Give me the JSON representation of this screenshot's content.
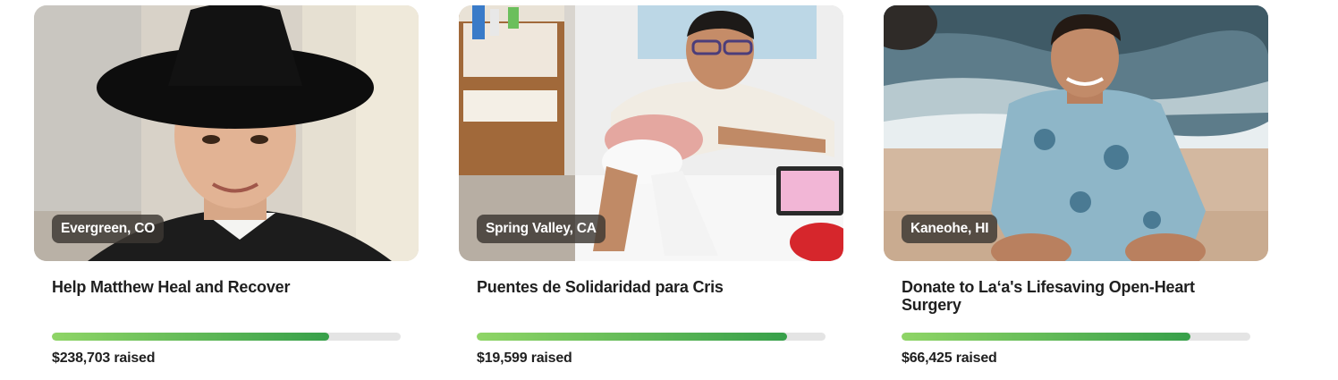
{
  "fundraisers": [
    {
      "location": "Evergreen, CO",
      "title": "Help Matthew Heal and Recover",
      "amount": "$238,703",
      "raised_suffix": "raised",
      "progress": 0.795
    },
    {
      "location": "Spring Valley, CA",
      "title": "Puentes de Solidaridad para Cris",
      "amount": "$19,599",
      "raised_suffix": "raised",
      "progress": 0.89
    },
    {
      "location": "Kaneohe, HI",
      "title": "Donate to La‘a's Lifesaving Open-Heart Surgery",
      "amount": "$66,425",
      "raised_suffix": "raised",
      "progress": 0.828
    }
  ],
  "colors": {
    "progress_start": "#8fd566",
    "progress_end": "#37a04a",
    "progress_track": "#e4e4e4",
    "location_badge": "#3c3732"
  }
}
